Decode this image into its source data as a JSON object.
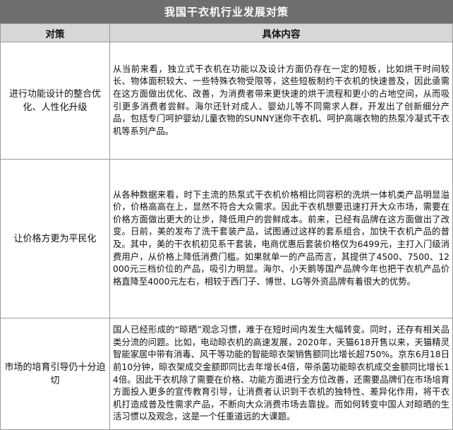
{
  "title": "我国干衣机行业发展对策",
  "header": {
    "col1": "对策",
    "col2": "具体内容"
  },
  "rows": [
    {
      "label": "进行功能设计的整合优化、人性化升级",
      "content": "从当前来看，独立式干衣机在功能以及设计方面仍存在一定的短板，比如烘干时间较长、物体面积较大、一些特殊衣物受限等，这些短板制约干衣机的快速普及，因此亟需在这方面做出优化、改善，为消费者带来更快速的烘干流程和更小的占地空间，从而吸引更多消费者尝鲜。海尔还针对成人、婴幼儿等不同需求人群，开发出了创新细分产品，包括专门呵护婴幼儿童衣物的SUNNY迷你干衣机、呵护高端衣物的热泵冷凝式干衣机等系列产品。"
    },
    {
      "label": "让价格方更为平民化",
      "content": "从各种数据来看，时下主流的热泵式干衣机价格相比同容积的洗烘一体机类产品明显溢价，价格高高在上，显然不符合大众需求。因此干衣机想要迅速打开大众市场，需要在价格方面做出更大的让步，降低用户的尝鲜成本。前来，已经有品牌在这方面做出了改变。日前，美的发布了洗干套装产品，试图通过这样的套系组合，加快干衣机产品的普及。其中，美的干衣机初见系干套装，电商优惠后套装价格仅为6499元，主打入门级消费用户，从价格上降低消费门槛。如果就单一的产品而言，其提供了4500、7500、12000元三档价位的产品，吸引力明显。海尔、小天鹅等国产品牌今年也把干衣机产品价格直降至4000元左右，相较于西门子、博世、LG等外资品牌有着很大的优势。"
    },
    {
      "label": "市场的培育引导仍十分迫切",
      "content": "国人已经形成的“晾晒”观念习惯，难于在短时间内发生大幅转变。同时，还存有相关品类分流的问题。比如，电动晾衣机的高速发展，2020年，天猫618开售以来，天猫精灵智能家居中带有消毒、风干等功能的智能晾衣架销售额同比增长超750%。京东6月18日前10分钟，晾衣架成交金额即同比去年增长4倍，带杀菌功能晾衣机成交金额同比增长14倍。因此干衣机除了需要在价格、功能方面进行全方位改善，还需要品牌们在市场培育方面投入更多的宣传教育引导，让消费者认识到干衣机的独特性、差异化作用，将干衣机打造成普及性需求产品，不断向大众消费市场去靠拢。而如何转变中国人对晾晒的生活习惯以及观念，这是一个任重道远的大课题。"
    }
  ]
}
